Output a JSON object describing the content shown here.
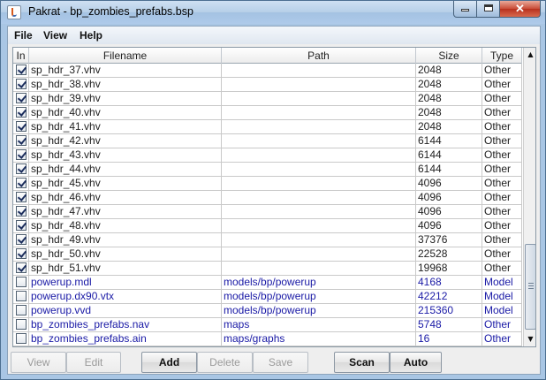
{
  "window": {
    "title": "Pakrat - bp_zombies_prefabs.bsp",
    "app_icon": "java-icon",
    "controls": {
      "minimize": "minimize-icon",
      "maximize": "maximize-icon",
      "close": "✕"
    }
  },
  "menu": [
    "File",
    "View",
    "Help"
  ],
  "table": {
    "columns": [
      "In",
      "Filename",
      "Path",
      "Size",
      "Type"
    ],
    "rows": [
      {
        "in": true,
        "filename": "sp_hdr_37.vhv",
        "path": "",
        "size": "2048",
        "type": "Other",
        "link": false
      },
      {
        "in": true,
        "filename": "sp_hdr_38.vhv",
        "path": "",
        "size": "2048",
        "type": "Other",
        "link": false
      },
      {
        "in": true,
        "filename": "sp_hdr_39.vhv",
        "path": "",
        "size": "2048",
        "type": "Other",
        "link": false
      },
      {
        "in": true,
        "filename": "sp_hdr_40.vhv",
        "path": "",
        "size": "2048",
        "type": "Other",
        "link": false
      },
      {
        "in": true,
        "filename": "sp_hdr_41.vhv",
        "path": "",
        "size": "2048",
        "type": "Other",
        "link": false
      },
      {
        "in": true,
        "filename": "sp_hdr_42.vhv",
        "path": "",
        "size": "6144",
        "type": "Other",
        "link": false
      },
      {
        "in": true,
        "filename": "sp_hdr_43.vhv",
        "path": "",
        "size": "6144",
        "type": "Other",
        "link": false
      },
      {
        "in": true,
        "filename": "sp_hdr_44.vhv",
        "path": "",
        "size": "6144",
        "type": "Other",
        "link": false
      },
      {
        "in": true,
        "filename": "sp_hdr_45.vhv",
        "path": "",
        "size": "4096",
        "type": "Other",
        "link": false
      },
      {
        "in": true,
        "filename": "sp_hdr_46.vhv",
        "path": "",
        "size": "4096",
        "type": "Other",
        "link": false
      },
      {
        "in": true,
        "filename": "sp_hdr_47.vhv",
        "path": "",
        "size": "4096",
        "type": "Other",
        "link": false
      },
      {
        "in": true,
        "filename": "sp_hdr_48.vhv",
        "path": "",
        "size": "4096",
        "type": "Other",
        "link": false
      },
      {
        "in": true,
        "filename": "sp_hdr_49.vhv",
        "path": "",
        "size": "37376",
        "type": "Other",
        "link": false
      },
      {
        "in": true,
        "filename": "sp_hdr_50.vhv",
        "path": "",
        "size": "22528",
        "type": "Other",
        "link": false
      },
      {
        "in": true,
        "filename": "sp_hdr_51.vhv",
        "path": "",
        "size": "19968",
        "type": "Other",
        "link": false
      },
      {
        "in": false,
        "filename": "powerup.mdl",
        "path": "models/bp/powerup",
        "size": "4168",
        "type": "Model",
        "link": true
      },
      {
        "in": false,
        "filename": "powerup.dx90.vtx",
        "path": "models/bp/powerup",
        "size": "42212",
        "type": "Model",
        "link": true
      },
      {
        "in": false,
        "filename": "powerup.vvd",
        "path": "models/bp/powerup",
        "size": "215360",
        "type": "Model",
        "link": true
      },
      {
        "in": false,
        "filename": "bp_zombies_prefabs.nav",
        "path": "maps",
        "size": "5748",
        "type": "Other",
        "link": true
      },
      {
        "in": false,
        "filename": "bp_zombies_prefabs.ain",
        "path": "maps/graphs",
        "size": "16",
        "type": "Other",
        "link": true
      }
    ]
  },
  "buttons": [
    {
      "label": "View",
      "enabled": false,
      "name": "view-button"
    },
    {
      "label": "Edit",
      "enabled": false,
      "name": "edit-button"
    },
    {
      "label": "Add",
      "enabled": true,
      "name": "add-button"
    },
    {
      "label": "Delete",
      "enabled": false,
      "name": "delete-button"
    },
    {
      "label": "Save",
      "enabled": false,
      "name": "save-button"
    },
    {
      "label": "Scan",
      "enabled": true,
      "name": "scan-button"
    },
    {
      "label": "Auto",
      "enabled": true,
      "name": "auto-button"
    }
  ],
  "scrollbar": {
    "up": "▲",
    "down": "▼"
  },
  "colors": {
    "link": "#1a1aa6",
    "titlebar": "#b6cfe8",
    "close": "#c84b36"
  }
}
